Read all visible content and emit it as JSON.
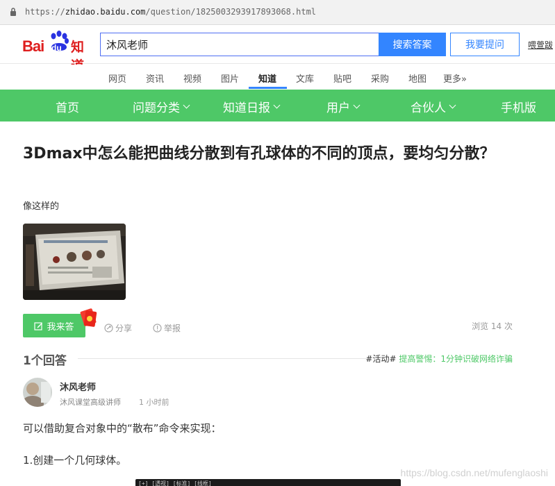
{
  "browser": {
    "url_prefix": "https://",
    "url_host": "zhidao.baidu.com",
    "url_path": "/question/1825003293917893068.html"
  },
  "header": {
    "logo_bai": "Bai",
    "logo_du": "du",
    "logo_zhidao": "知道",
    "search_value": "沐风老师",
    "search_button": "搜索答案",
    "ask_button": "我要提问",
    "login_link": "喂萱跋"
  },
  "navtabs": [
    {
      "label": "网页"
    },
    {
      "label": "资讯"
    },
    {
      "label": "视频"
    },
    {
      "label": "图片"
    },
    {
      "label": "知道",
      "active": true
    },
    {
      "label": "文库"
    },
    {
      "label": "贴吧"
    },
    {
      "label": "采购"
    },
    {
      "label": "地图"
    },
    {
      "label": "更多»"
    }
  ],
  "greenbar": {
    "home": "首页",
    "category": "问题分类",
    "daily": "知道日报",
    "user": "用户",
    "partner": "合伙人",
    "mobile": "手机版"
  },
  "question": {
    "title": "3Dmax中怎么能把曲线分散到有孔球体的不同的顶点，要均匀分散？",
    "description": "像这样的",
    "answer_button": "我来答",
    "share": "分享",
    "report": "举报",
    "views": "浏览 14 次"
  },
  "answers": {
    "count_label": "1个回答",
    "activity_tag": "#活动#",
    "activity_link": "提高警惕：1分钟识破网络诈骗"
  },
  "answer": {
    "user_name": "沐风老师",
    "user_title": "沐风课堂高级讲师",
    "time": "1 小时前",
    "paragraph1": "可以借助复合对象中的“散布”命令来实现：",
    "paragraph2": "1.创建一个几何球体。",
    "code_caption": "[+] [透视] [标准] [线框]"
  },
  "watermark": "https://blog.csdn.net/mufenglaoshi",
  "colors": {
    "green": "#4ec867",
    "blue": "#3385ff",
    "baidu_red": "#de1e1e"
  }
}
